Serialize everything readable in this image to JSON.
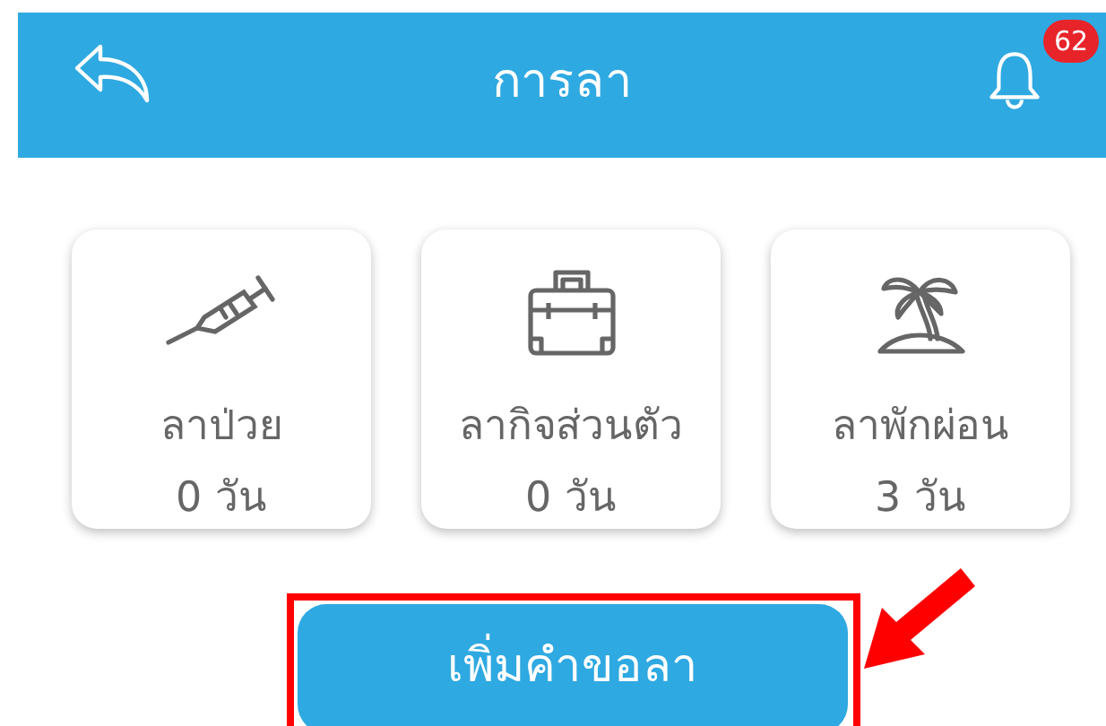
{
  "header": {
    "title": "การลา",
    "notification_count": "62"
  },
  "leave_types": [
    {
      "kind": "syringe",
      "label": "ลาป่วย",
      "days": "0 วัน"
    },
    {
      "kind": "briefcase",
      "label": "ลากิจส่วนตัว",
      "days": "0 วัน"
    },
    {
      "kind": "palm",
      "label": "ลาพักผ่อน",
      "days": "3 วัน"
    }
  ],
  "add_button": {
    "label": "เพิ่มคำขอลา",
    "highlighted": true
  }
}
